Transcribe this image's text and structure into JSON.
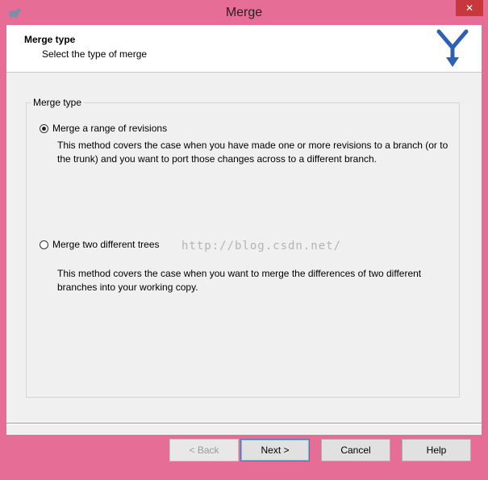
{
  "window": {
    "title": "Merge",
    "close_symbol": "✕",
    "accent_color": "#e66e96"
  },
  "header": {
    "title": "Merge type",
    "subtitle": "Select the type of merge",
    "logo_icon": "merge-arrow-icon"
  },
  "group": {
    "legend": "Merge type",
    "options": [
      {
        "label": "Merge a range of revisions",
        "selected": true,
        "description": "This method covers the case when you have made one or more revisions to a branch (or to the trunk) and you want to port those changes across to a different branch."
      },
      {
        "label": "Merge two different trees",
        "selected": false,
        "description": "This method covers the case when you want to merge the differences of two different branches into your working copy."
      }
    ]
  },
  "watermark": "http://blog.csdn.net/",
  "buttons": {
    "back": "< Back",
    "next": "Next >",
    "cancel": "Cancel",
    "help": "Help"
  }
}
